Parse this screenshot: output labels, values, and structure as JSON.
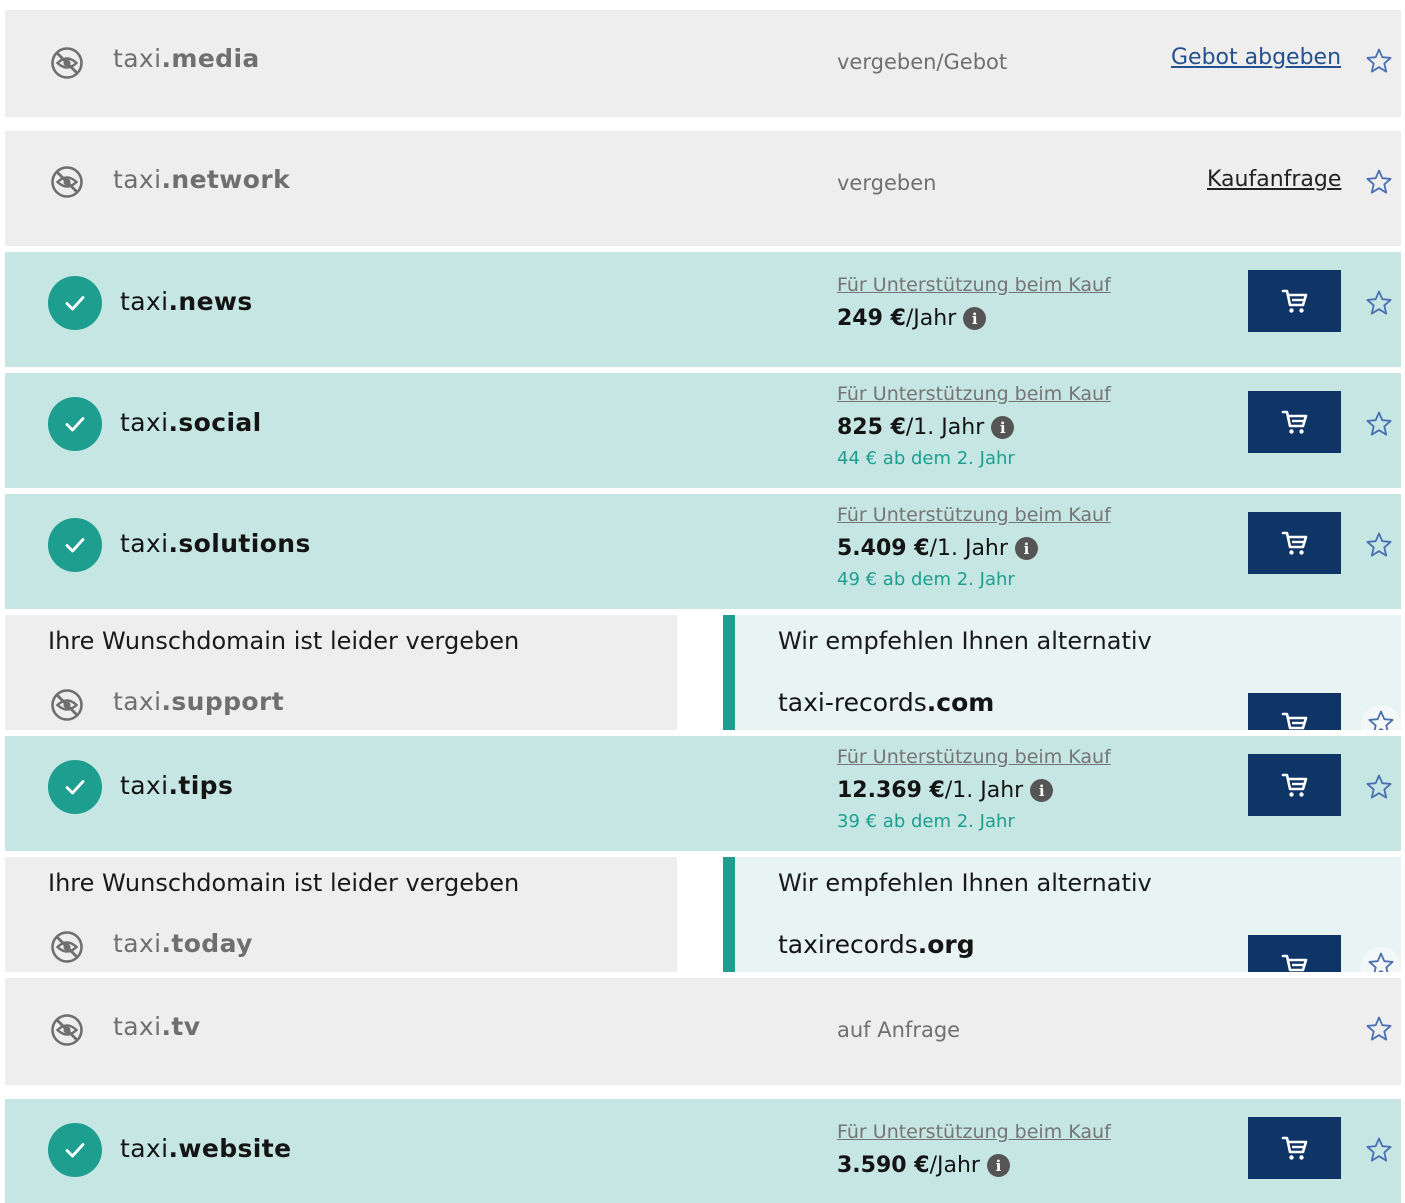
{
  "support_label": "Für Unterstützung beim Kauf",
  "rows": {
    "media": {
      "prefix": "taxi",
      "tld": ".media",
      "status": "vergeben/Gebot",
      "action": "Gebot abgeben"
    },
    "network": {
      "prefix": "taxi",
      "tld": ".network",
      "status": "vergeben",
      "action": "Kaufanfrage"
    },
    "news": {
      "prefix": "taxi",
      "tld": ".news",
      "price": "249 €",
      "period": "/Jahr"
    },
    "social": {
      "prefix": "taxi",
      "tld": ".social",
      "price": "825 €",
      "period": "/1. Jahr",
      "renewal": "44 € ab dem 2. Jahr"
    },
    "solutions": {
      "prefix": "taxi",
      "tld": ".solutions",
      "price": "5.409 €",
      "period": "/1. Jahr",
      "renewal": "49 € ab dem 2. Jahr"
    },
    "support": {
      "sorry": "Ihre Wunschdomain ist leider vergeben",
      "prefix": "taxi",
      "tld": ".support",
      "suggest_title": "Wir empfehlen Ihnen alternativ",
      "alt_prefix": "taxi-records",
      "alt_tld": ".com"
    },
    "tips": {
      "prefix": "taxi",
      "tld": ".tips",
      "price": "12.369 €",
      "period": "/1. Jahr",
      "renewal": "39 € ab dem 2. Jahr"
    },
    "today": {
      "sorry": "Ihre Wunschdomain ist leider vergeben",
      "prefix": "taxi",
      "tld": ".today",
      "suggest_title": "Wir empfehlen Ihnen alternativ",
      "alt_prefix": "taxirecords",
      "alt_tld": ".org"
    },
    "tv": {
      "prefix": "taxi",
      "tld": ".tv",
      "status": "auf Anfrage"
    },
    "website": {
      "prefix": "taxi",
      "tld": ".website",
      "price": "3.590 €",
      "period": "/Jahr"
    }
  },
  "colors": {
    "available_bg": "#c6e6e3",
    "taken_bg": "#eeeeee",
    "accent": "#1d9e8f",
    "cart_bg": "#0f3566",
    "link_blue": "#24508e"
  },
  "icons": {
    "available": "check-circle-icon",
    "taken": "eye-off-icon",
    "cart": "cart-icon",
    "watchlist": "star-outline-icon",
    "info": "info-icon"
  }
}
